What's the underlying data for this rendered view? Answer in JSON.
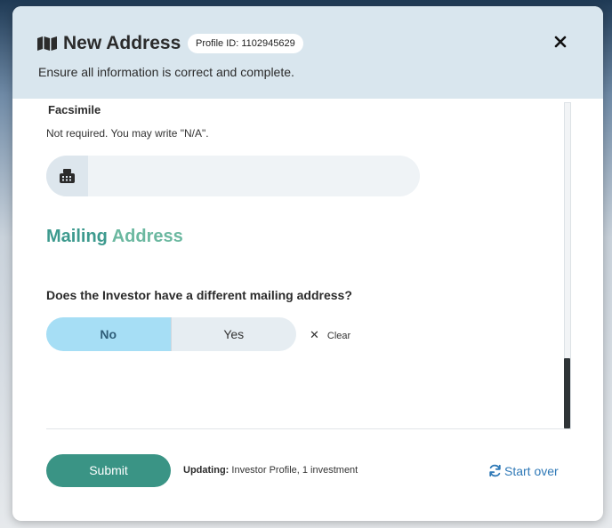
{
  "header": {
    "title": "New Address",
    "profile_badge": "Profile ID: 1102945629",
    "subtitle": "Ensure all information is correct and complete."
  },
  "facsimile": {
    "label": "Facsimile",
    "help": "Not required. You may write \"N/A\".",
    "value": "",
    "icon": "fax-icon"
  },
  "mailing": {
    "section_title_1": "Mailing",
    "section_title_2": "Address",
    "question": "Does the Investor have a different mailing address?",
    "options": [
      "No",
      "Yes"
    ],
    "selected": "No",
    "clear_label": "Clear"
  },
  "footer": {
    "submit_label": "Submit",
    "updating_label": "Updating:",
    "updating_value": "Investor Profile, 1 investment",
    "start_over_label": "Start over"
  },
  "colors": {
    "header_bg": "#d9e6ee",
    "accent": "#3a9485",
    "selected_option": "#a6def5",
    "link": "#2f79b7"
  }
}
